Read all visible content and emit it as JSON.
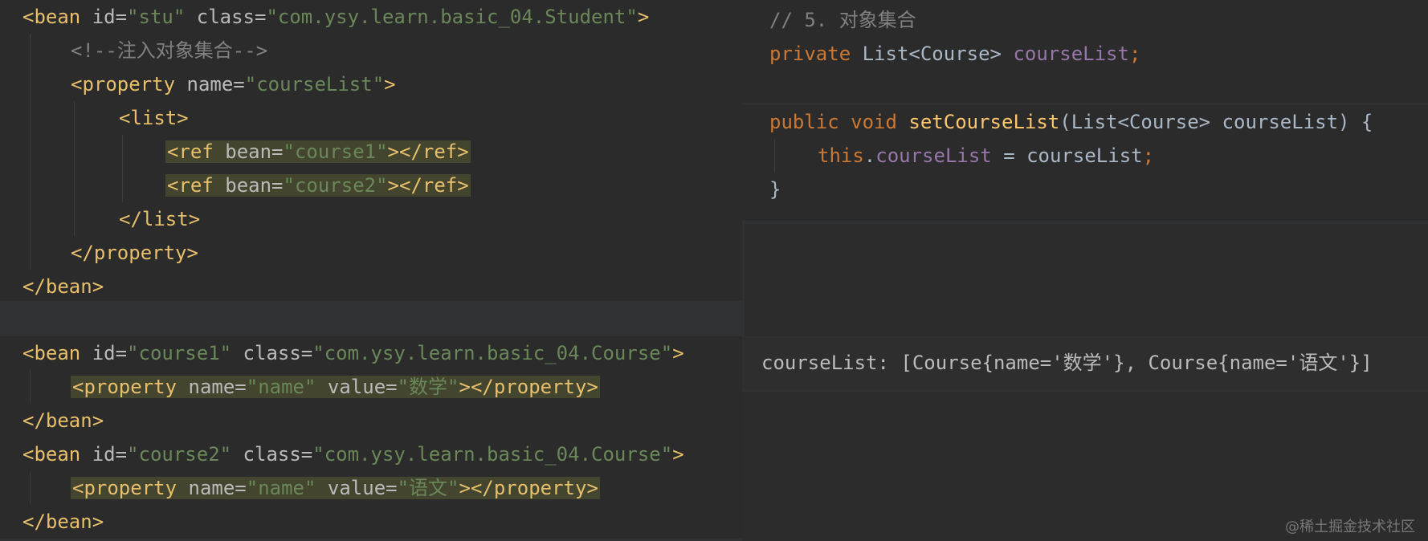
{
  "xml_bean_stu": {
    "bean_open": {
      "open": "<bean",
      "id_attr": " id=",
      "id_value": "\"stu\"",
      "class_attr": " class=",
      "class_value": "\"com.ysy.learn.basic_04.Student\"",
      "close": ">"
    },
    "comment": "<!--注入对象集合-->",
    "property_open": {
      "open": "<property",
      "name_attr": " name=",
      "name_value": "\"courseList\"",
      "close": ">"
    },
    "list_open": "<list>",
    "refs": [
      {
        "open": "<ref",
        "bean_attr": " bean=",
        "bean_value": "\"course1\"",
        "close": "></ref>"
      },
      {
        "open": "<ref",
        "bean_attr": " bean=",
        "bean_value": "\"course2\"",
        "close": "></ref>"
      }
    ],
    "list_close": "</list>",
    "property_close": "</property>",
    "bean_close": "</bean>"
  },
  "xml_course_beans": [
    {
      "bean_open": {
        "open": "<bean",
        "id_attr": " id=",
        "id_value": "\"course1\"",
        "class_attr": " class=",
        "class_value": "\"com.ysy.learn.basic_04.Course\"",
        "close": ">"
      },
      "property": {
        "open": "<property",
        "name_attr": " name=",
        "name_value": "\"name\"",
        "value_attr": " value=",
        "value_value": "\"数学\"",
        "close": "></property>"
      },
      "bean_close": "</bean>"
    },
    {
      "bean_open": {
        "open": "<bean",
        "id_attr": " id=",
        "id_value": "\"course2\"",
        "class_attr": " class=",
        "class_value": "\"com.ysy.learn.basic_04.Course\"",
        "close": ">"
      },
      "property": {
        "open": "<property",
        "name_attr": " name=",
        "name_value": "\"name\"",
        "value_attr": " value=",
        "value_value": "\"语文\"",
        "close": "></property>"
      },
      "bean_close": "</bean>"
    }
  ],
  "java_field": {
    "comment": "// 5. 对象集合",
    "modifier": "private",
    "type": " List<Course> ",
    "name": "courseList",
    "semicolon": ";"
  },
  "java_setter": {
    "keyword_public": "public",
    "keyword_void": " void ",
    "method_name": "setCourseList",
    "params": "(List<Course> courseList) {",
    "this_kw": "this",
    "dot": ".",
    "field": "courseList",
    "assign": " = courseList",
    "semicolon": ";",
    "close_brace": "}"
  },
  "output": {
    "text": "courseList: [Course{name='数学'}, Course{name='语文'}]"
  },
  "watermark": "@稀土掘金技术社区"
}
